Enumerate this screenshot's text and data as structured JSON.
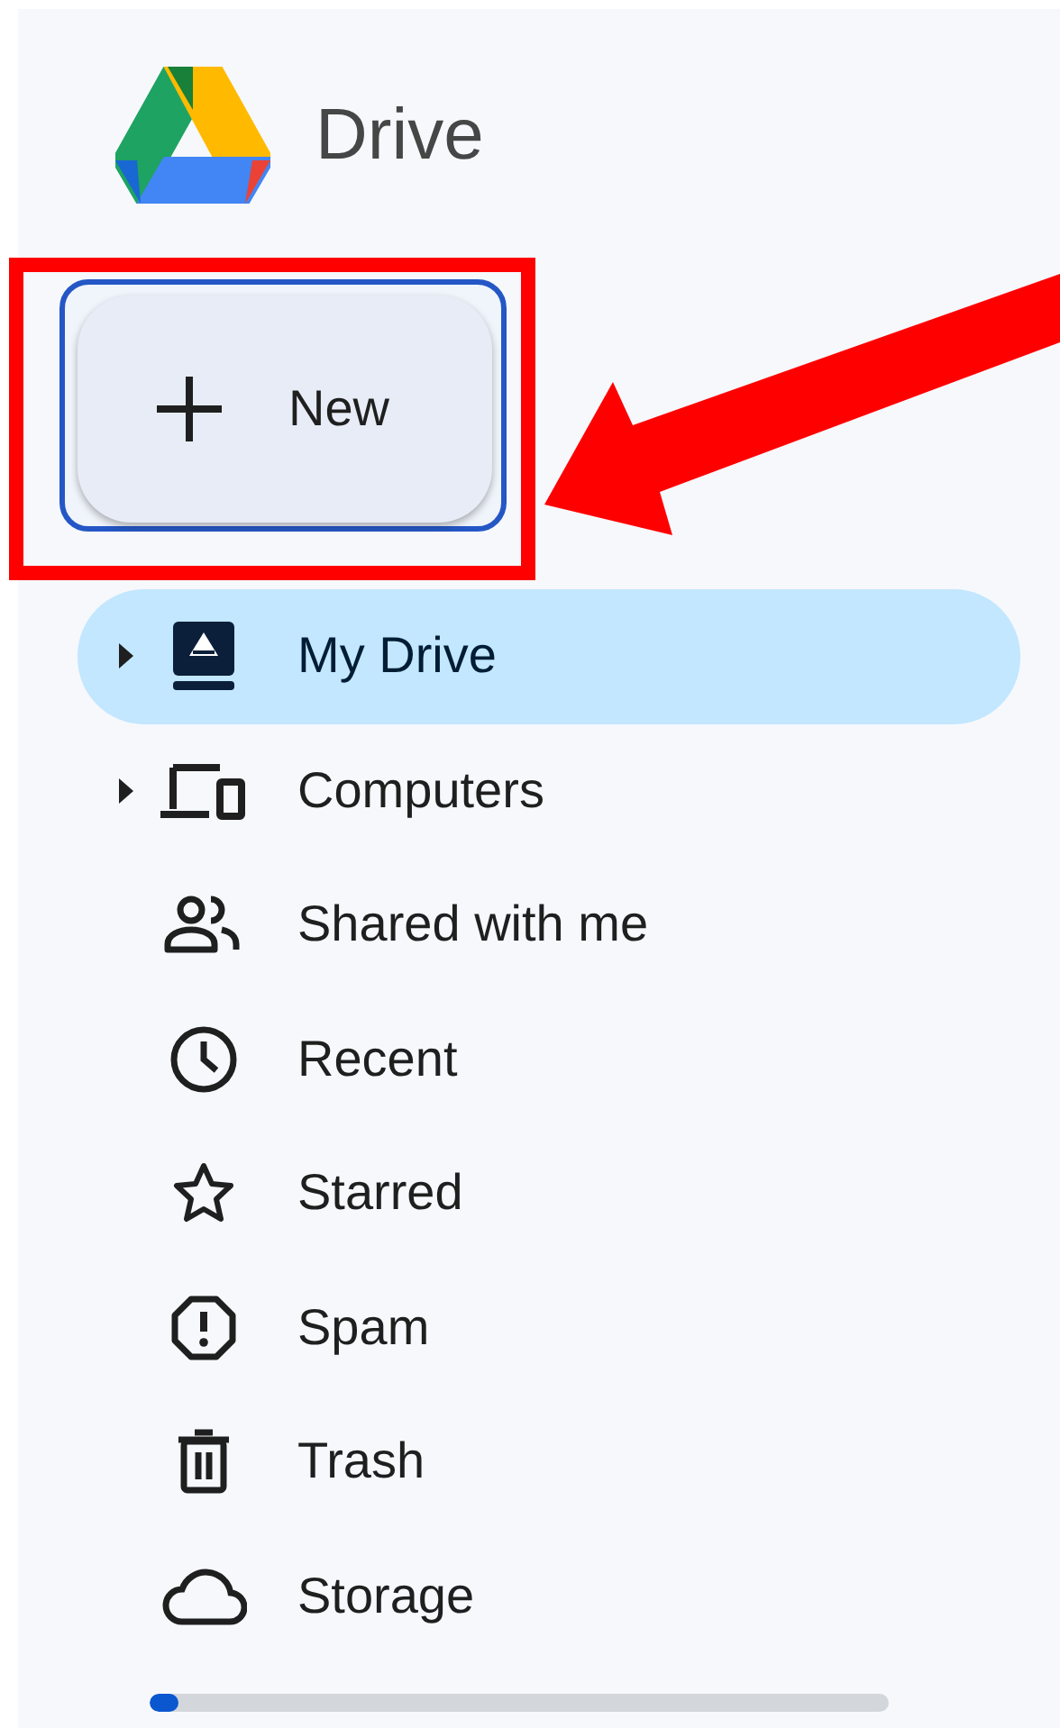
{
  "app": {
    "title": "Drive"
  },
  "new_button": {
    "label": "New"
  },
  "sidebar": {
    "items": [
      {
        "label": "My Drive",
        "selected": true,
        "expandable": true
      },
      {
        "label": "Computers",
        "selected": false,
        "expandable": true
      },
      {
        "label": "Shared with me",
        "selected": false,
        "expandable": false
      },
      {
        "label": "Recent",
        "selected": false,
        "expandable": false
      },
      {
        "label": "Starred",
        "selected": false,
        "expandable": false
      },
      {
        "label": "Spam",
        "selected": false,
        "expandable": false
      },
      {
        "label": "Trash",
        "selected": false,
        "expandable": false
      },
      {
        "label": "Storage",
        "selected": false,
        "expandable": false
      }
    ]
  },
  "storage": {
    "level": 0.04
  }
}
